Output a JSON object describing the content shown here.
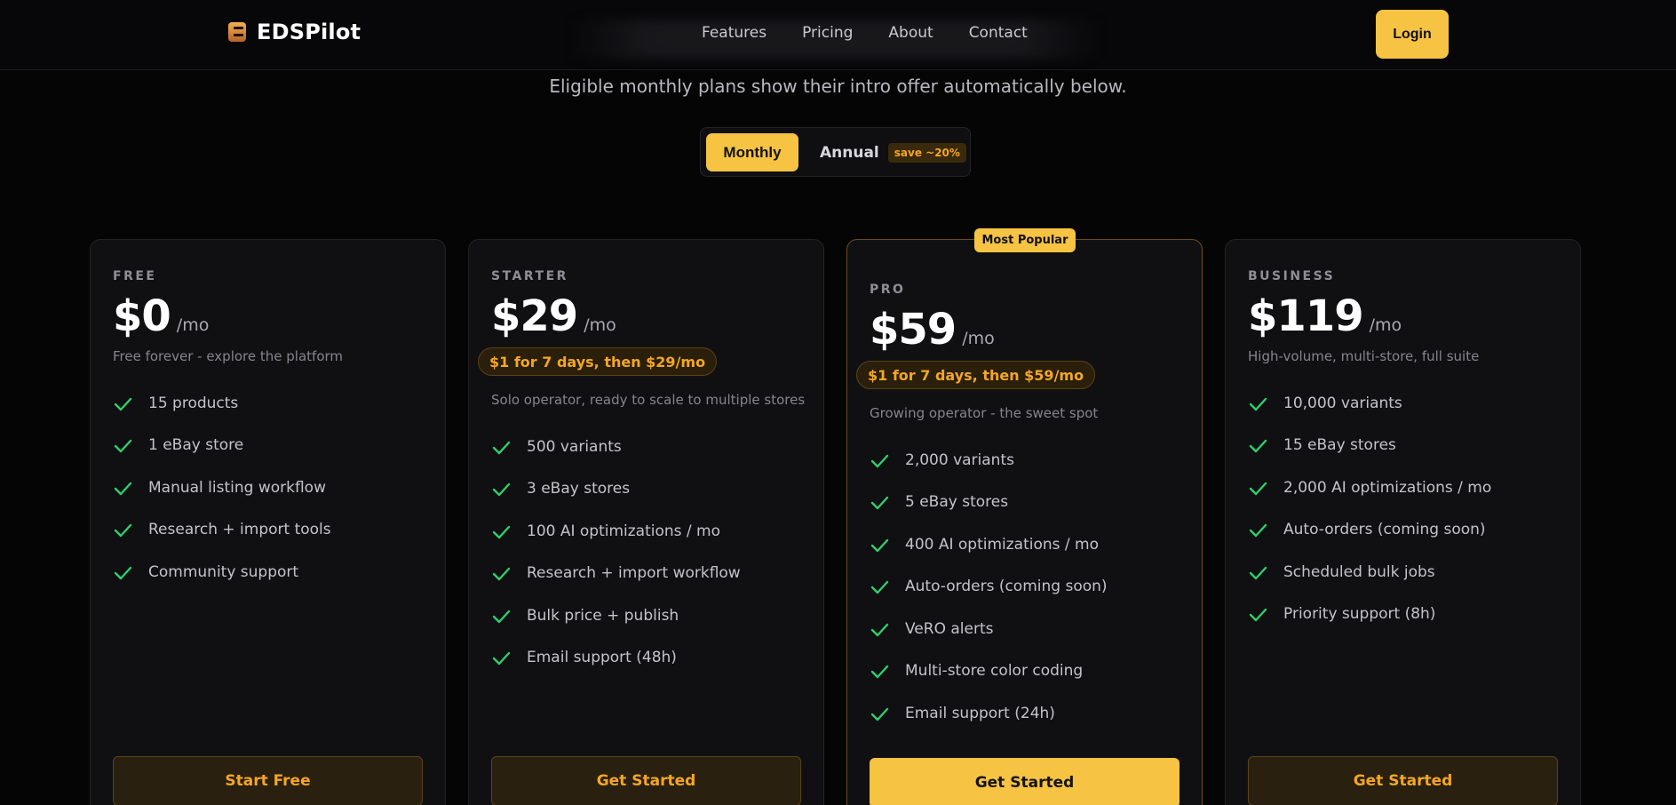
{
  "navbar": {
    "brand": "EDSPilot",
    "links": [
      "Features",
      "Pricing",
      "About",
      "Contact"
    ],
    "login_label": "Login"
  },
  "intro": {
    "subtitle": "Eligible monthly plans show their intro offer automatically below."
  },
  "billing_toggle": {
    "monthly_label": "Monthly",
    "annual_label": "Annual",
    "annual_badge": "save ~20%",
    "selected": "Monthly"
  },
  "plans": [
    {
      "tier": "FREE",
      "price": "$0",
      "period": "/mo",
      "offer": "",
      "description": "Free forever - explore the platform",
      "features": [
        "15 products",
        "1 eBay store",
        "Manual listing workflow",
        "Research + import tools",
        "Community support"
      ],
      "cta": "Start Free"
    },
    {
      "tier": "STARTER",
      "price": "$29",
      "period": "/mo",
      "offer": "$1 for 7 days, then $29/mo",
      "description": "Solo operator, ready to scale to multiple stores",
      "features": [
        "500 variants",
        "3 eBay stores",
        "100 AI optimizations / mo",
        "Research + import workflow",
        "Bulk price + publish",
        "Email support (48h)"
      ],
      "cta": "Get Started"
    },
    {
      "tier": "PRO",
      "badge": "Most Popular",
      "price": "$59",
      "period": "/mo",
      "offer": "$1 for 7 days, then $59/mo",
      "description": "Growing operator - the sweet spot",
      "features": [
        "2,000 variants",
        "5 eBay stores",
        "400 AI optimizations / mo",
        "Auto-orders (coming soon)",
        "VeRO alerts",
        "Multi-store color coding",
        "Email support (24h)"
      ],
      "cta": "Get Started"
    },
    {
      "tier": "BUSINESS",
      "price": "$119",
      "period": "/mo",
      "offer": "",
      "description": "High-volume, multi-store, full suite",
      "features": [
        "10,000 variants",
        "15 eBay stores",
        "2,000 AI optimizations / mo",
        "Auto-orders (coming soon)",
        "Scheduled bulk jobs",
        "Priority support (8h)"
      ],
      "cta": "Get Started"
    }
  ],
  "colors": {
    "accent": "#f6c342",
    "offer_text": "#f5a623",
    "check": "#2fcf6b",
    "background": "#050506",
    "card": "#101013"
  },
  "icons": {
    "logo": "stacked-bars-logo-icon",
    "feature": "check-icon"
  }
}
